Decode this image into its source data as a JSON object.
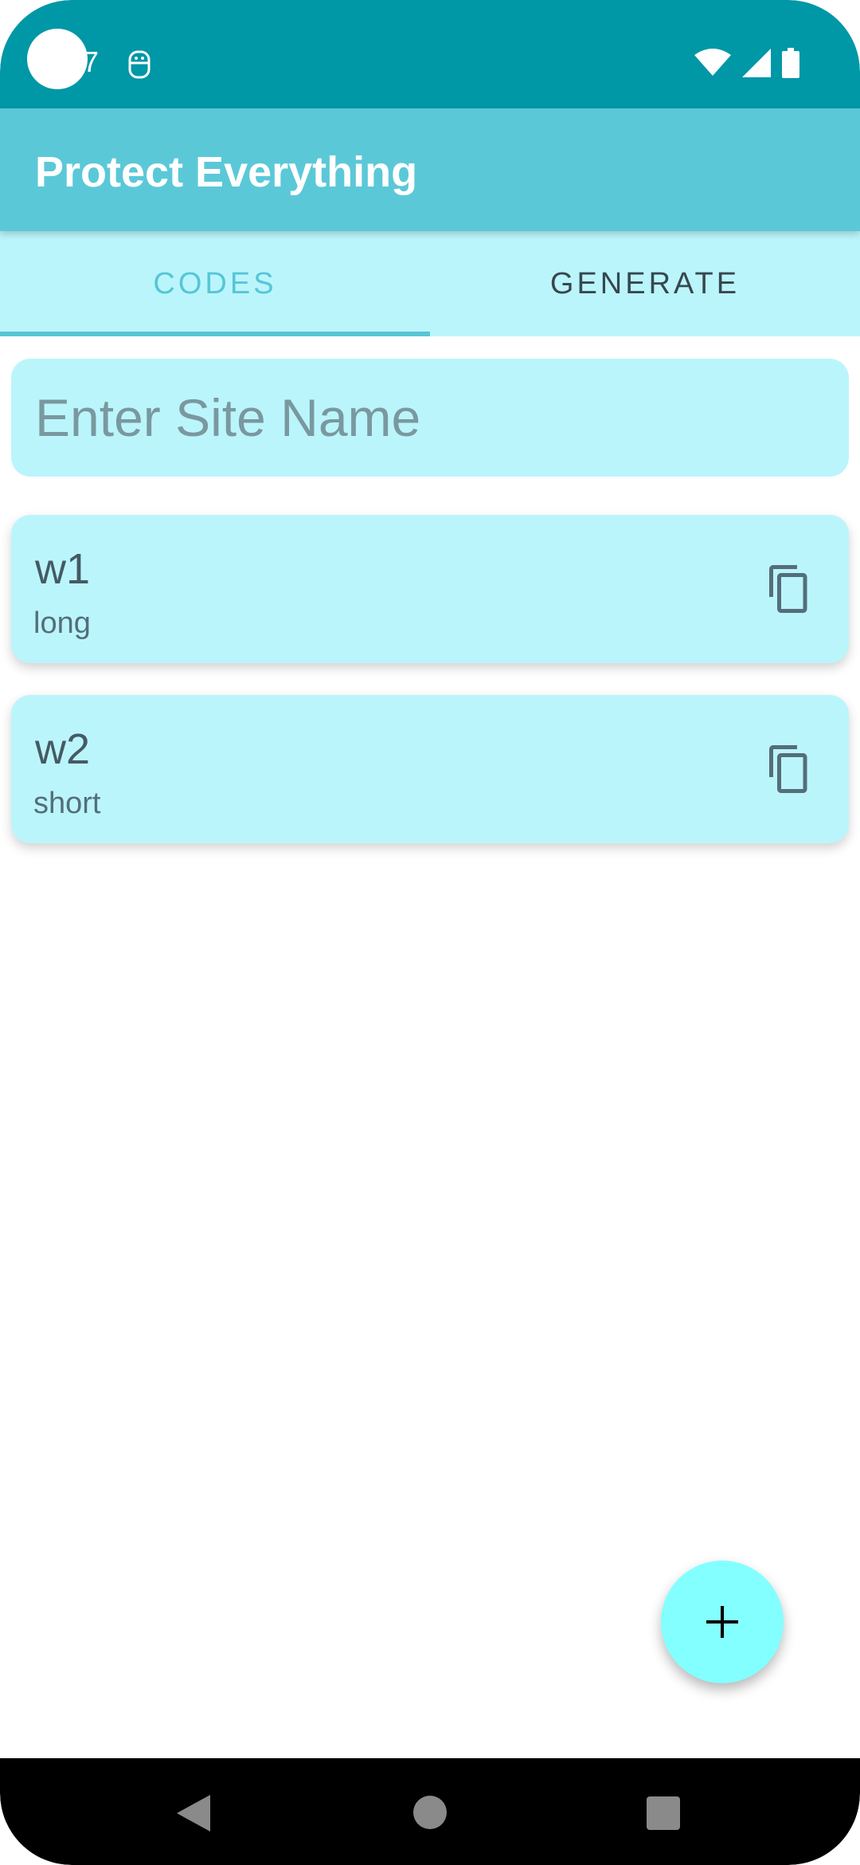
{
  "status_bar": {
    "time": "7",
    "icons": [
      "notification-icon",
      "wifi-icon",
      "signal-icon",
      "battery-icon"
    ]
  },
  "app_bar": {
    "title": "Protect Everything"
  },
  "tabs": [
    {
      "label": "CODES",
      "selected": true
    },
    {
      "label": "GENERATE",
      "selected": false
    }
  ],
  "search": {
    "value": "",
    "placeholder": "Enter Site Name"
  },
  "entries": [
    {
      "name": "w1",
      "type": "long",
      "icon": "copy-icon"
    },
    {
      "name": "w2",
      "type": "short",
      "icon": "copy-icon"
    }
  ],
  "fab": {
    "icon": "plus-icon"
  },
  "nav": {
    "icons": [
      "back-icon",
      "home-icon",
      "recents-icon"
    ]
  },
  "colors": {
    "status_bar": "#0097a7",
    "app_bar": "#5bc8d8",
    "tab_background": "#bbf5fc",
    "accent": "#57c6d6",
    "card": "#bbf5fc",
    "fab": "#84ffff"
  }
}
